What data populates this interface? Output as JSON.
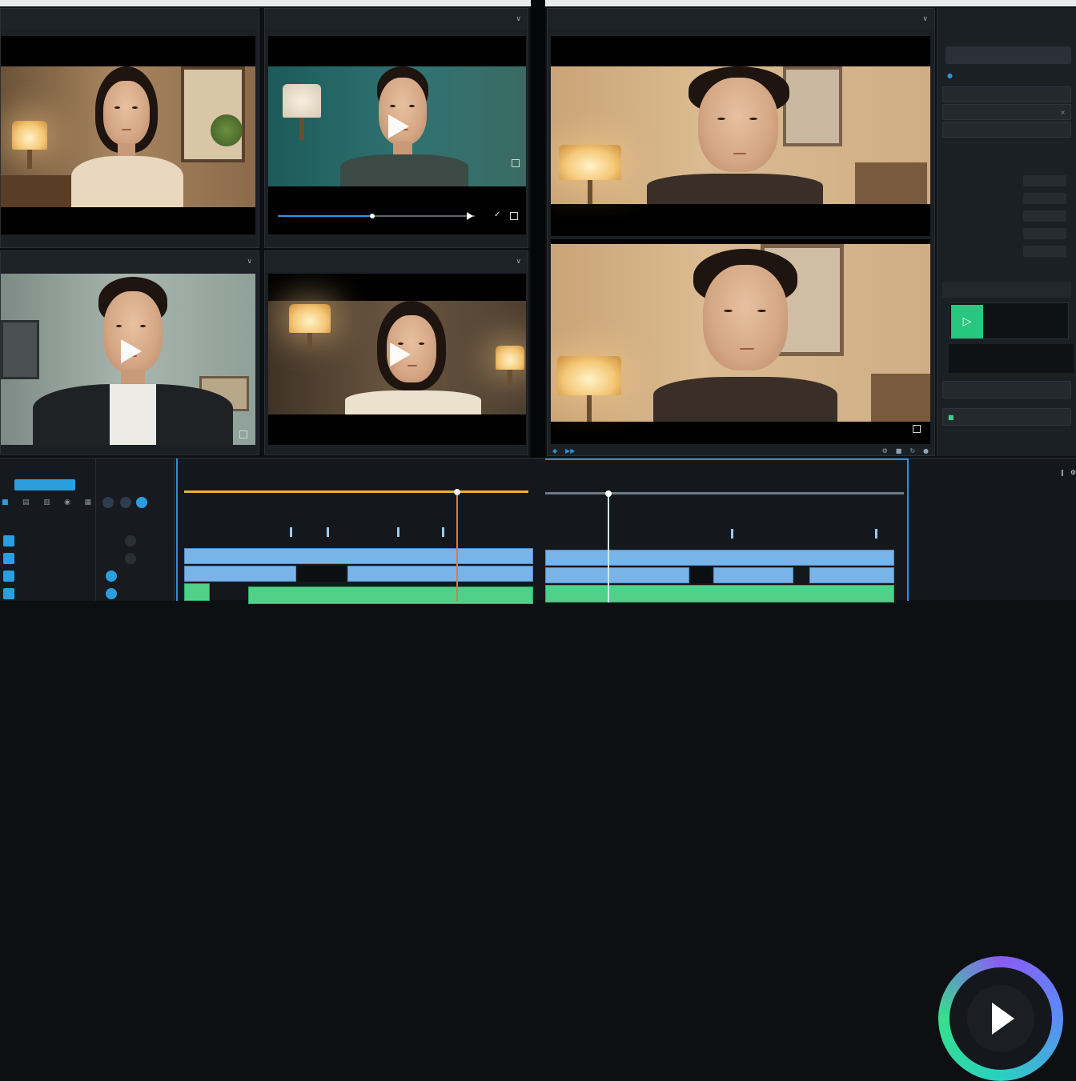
{
  "colors": {
    "accent": "#2d8fd6",
    "ruler": "#e4b62e",
    "clip_video": "#79b4e8",
    "clip_audio": "#4fd18a",
    "playhead_left": "#e07a3a",
    "playhead_right": "#cfe6ff"
  },
  "panels": [
    {
      "id": "p1",
      "title": "",
      "foot_left": "",
      "foot_right": ""
    },
    {
      "id": "p2",
      "title": "",
      "foot_left": "",
      "foot_right": ""
    },
    {
      "id": "p3",
      "title": "",
      "foot_left": "",
      "foot_right": ""
    },
    {
      "id": "p4",
      "title": "",
      "foot_left": "",
      "foot_right": ""
    },
    {
      "id": "p5",
      "title": "",
      "foot_left": "",
      "foot_right": ""
    }
  ],
  "playback": {
    "progress": 0.48
  },
  "right_panel": {
    "tab_1": "",
    "tab_2": "",
    "section_1": "",
    "primary_button": "",
    "section_2": "",
    "rows": [
      "",
      "",
      "",
      "",
      "",
      "",
      "",
      ""
    ],
    "section_3": "",
    "section_4": "",
    "section_5": ""
  },
  "timeline": {
    "title": "",
    "tick_labels": [
      "",
      "",
      "",
      "",
      "",
      "",
      "",
      "",
      "",
      "",
      "",
      "",
      "",
      ""
    ],
    "track_labels": [
      "",
      "",
      "",
      "",
      ""
    ],
    "transport_label": ""
  },
  "icons": [
    "play-icon",
    "chevron-down-icon",
    "fullscreen-icon",
    "check-icon",
    "scissors-icon",
    "link-icon",
    "waveform-icon",
    "settings-icon"
  ]
}
